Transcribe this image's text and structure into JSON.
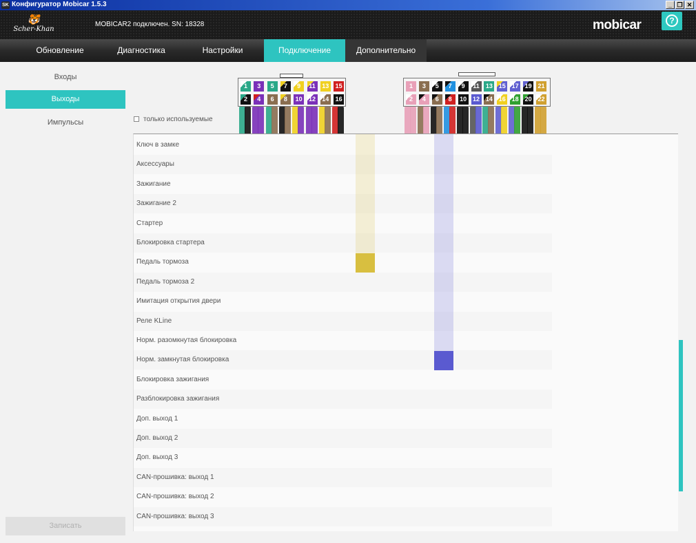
{
  "window": {
    "title": "Конфигуратор Mobicar 1.5.3",
    "icon": "app-icon"
  },
  "header": {
    "logo": "Scher-Khan",
    "status": "MOBICAR2 подключен. SN: 18328",
    "brand": "mobicar",
    "help_icon": "help-icon"
  },
  "nav": {
    "tabs": [
      {
        "label": "Обновление"
      },
      {
        "label": "Диагностика"
      },
      {
        "label": "Настройки"
      },
      {
        "label": "Подключение",
        "active": true
      },
      {
        "label": "Дополнительно"
      }
    ]
  },
  "sidebar": {
    "items": [
      {
        "label": "Входы"
      },
      {
        "label": "Выходы",
        "active": true
      },
      {
        "label": "Импульсы"
      }
    ],
    "write_button": "Записать"
  },
  "filter": {
    "only_used_label": "только используемые",
    "checked": false
  },
  "connector_left": {
    "top": [
      {
        "n": "1",
        "color": "#2aa888",
        "stripe": "#ffffff"
      },
      {
        "n": "3",
        "color": "#7a30b8"
      },
      {
        "n": "5",
        "color": "#2aa888"
      },
      {
        "n": "7",
        "color": "#111111",
        "stripe": "#f0d020"
      },
      {
        "n": "9",
        "color": "#f0d020",
        "stripe": "#ffffff"
      },
      {
        "n": "11",
        "color": "#7a30b8",
        "stripe": "#f0d020"
      },
      {
        "n": "13",
        "color": "#f0d020"
      },
      {
        "n": "15",
        "color": "#d02020"
      }
    ],
    "bottom": [
      {
        "n": "2",
        "color": "#111111",
        "stripe": "#2aa888"
      },
      {
        "n": "4",
        "color": "#7a30b8",
        "stripe": "#d02020"
      },
      {
        "n": "6",
        "color": "#8a6e50"
      },
      {
        "n": "8",
        "color": "#8a6e50",
        "stripe": "#f0d020"
      },
      {
        "n": "10",
        "color": "#7a30b8"
      },
      {
        "n": "12",
        "color": "#7a30b8",
        "stripe": "#ffffff"
      },
      {
        "n": "14",
        "color": "#8a6e50",
        "stripe": "#ffffff"
      },
      {
        "n": "16",
        "color": "#111111"
      }
    ]
  },
  "connector_right": {
    "top": [
      {
        "n": "1",
        "color": "#e8a0b8"
      },
      {
        "n": "3",
        "color": "#8a6e50"
      },
      {
        "n": "5",
        "color": "#111111",
        "stripe": "#ffffff"
      },
      {
        "n": "7",
        "color": "#2090e0",
        "stripe": "#111111"
      },
      {
        "n": "9",
        "color": "#111111",
        "stripe": "#ffffff"
      },
      {
        "n": "11",
        "color": "#555555",
        "stripe": "#ffffff"
      },
      {
        "n": "13",
        "color": "#2aa888"
      },
      {
        "n": "15",
        "color": "#6060d0",
        "stripe": "#f0d020"
      },
      {
        "n": "17",
        "color": "#6060d0",
        "stripe": "#ffffff"
      },
      {
        "n": "19",
        "color": "#111111",
        "stripe": "#6060d0"
      },
      {
        "n": "21",
        "color": "#d0a030"
      }
    ],
    "bottom": [
      {
        "n": "2",
        "color": "#e8a0b8",
        "stripe": "#ffffff"
      },
      {
        "n": "4",
        "color": "#e8a0b8",
        "stripe": "#111111"
      },
      {
        "n": "6",
        "color": "#8a6e50",
        "stripe": "#111111"
      },
      {
        "n": "8",
        "color": "#d02020",
        "stripe": "#111111"
      },
      {
        "n": "10",
        "color": "#111111"
      },
      {
        "n": "12",
        "color": "#5a5ad0"
      },
      {
        "n": "14",
        "color": "#8a6e50",
        "stripe": "#111111"
      },
      {
        "n": "16",
        "color": "#f0d020",
        "stripe": "#ffffff"
      },
      {
        "n": "18",
        "color": "#30a030",
        "stripe": "#ffffff"
      },
      {
        "n": "20",
        "color": "#111111",
        "stripe": "#30a030"
      },
      {
        "n": "22",
        "color": "#d0a030",
        "stripe": "#ffffff"
      }
    ]
  },
  "outputs": [
    "Ключ в замке",
    "Аксессуары",
    "Зажигание",
    "Зажигание 2",
    "Стартер",
    "Блокировка стартера",
    "Педаль тормоза",
    "Педаль тормоза 2",
    "Имитация открытия двери",
    "Реле KLine",
    "Норм. разомкнутая блокировка",
    "Норм. замкнутая блокировка",
    "Блокировка зажигания",
    "Разблокировка зажигания",
    "Доп. выход 1",
    "Доп. выход 2",
    "Доп. выход 3",
    "CAN-прошивка: выход 1",
    "CAN-прошивка: выход 2",
    "CAN-прошивка: выход 3"
  ],
  "assignments": [
    {
      "wire_color": "#d8bf40",
      "row": 6
    },
    {
      "wire_color": "#5a5ad0",
      "row": 11
    }
  ]
}
